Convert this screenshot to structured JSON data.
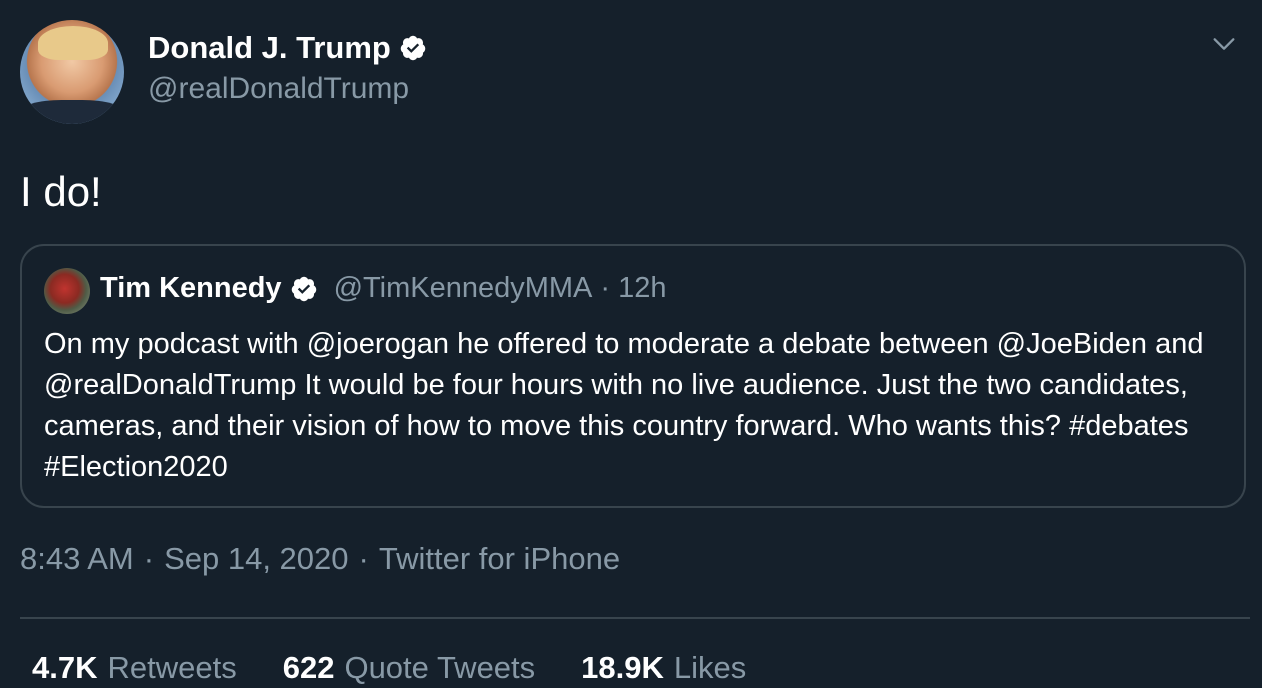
{
  "colors": {
    "background": "#15202b",
    "primary_text": "#ffffff",
    "secondary_text": "#8899a6",
    "border": "#38444d"
  },
  "author": {
    "name": "Donald J. Trump",
    "handle": "@realDonaldTrump",
    "verified_icon": "verified-badge-icon"
  },
  "menu_icon": "chevron-down-icon",
  "tweet": {
    "text": "I do!"
  },
  "quoted": {
    "name": "Tim Kennedy",
    "handle": "@TimKennedyMMA",
    "separator": "·",
    "time": "12h",
    "text": "On my podcast with @joerogan he offered to moderate a debate between @JoeBiden and @realDonaldTrump It would be four hours with no live audience. Just the two candidates, cameras, and their vision of how to move this country forward. Who wants this? #debates #Election2020"
  },
  "meta": {
    "time": "8:43 AM",
    "date": "Sep 14, 2020",
    "source": "Twitter for iPhone",
    "separator": "·"
  },
  "stats": [
    {
      "count": "4.7K",
      "label": "Retweets"
    },
    {
      "count": "622",
      "label": "Quote Tweets"
    },
    {
      "count": "18.9K",
      "label": "Likes"
    }
  ]
}
